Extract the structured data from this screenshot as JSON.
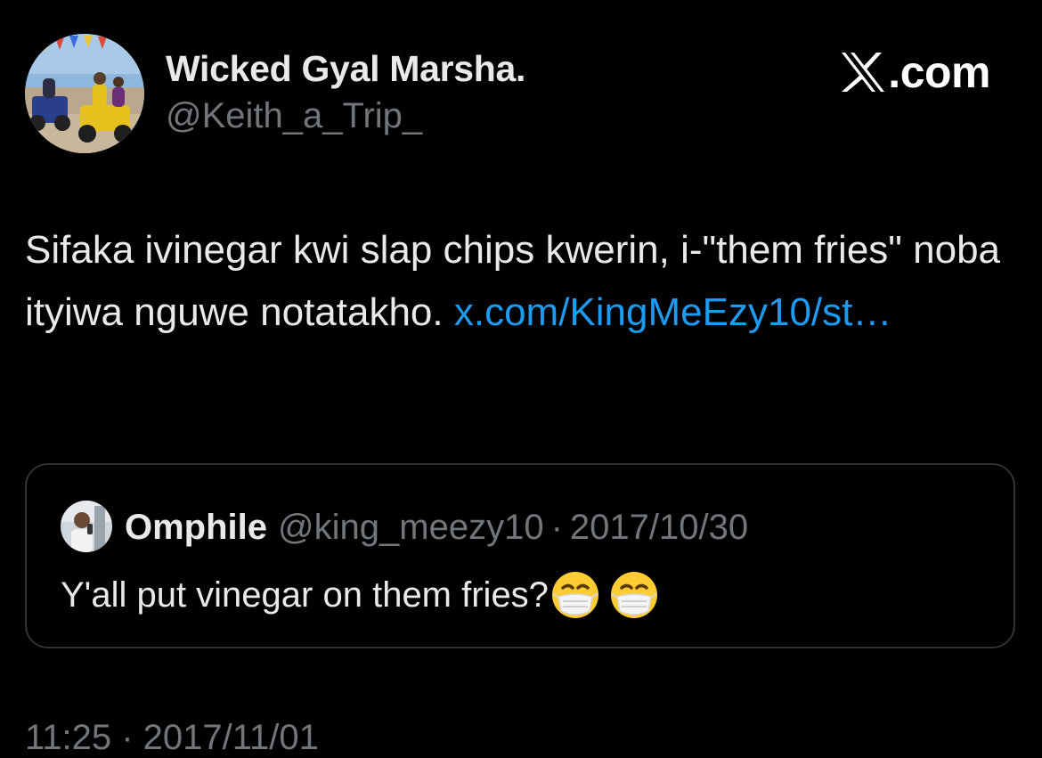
{
  "author": {
    "display_name": "Wicked Gyal Marsha.",
    "handle": "@Keith_a_Trip_"
  },
  "brand": {
    "text": ".com",
    "icon": "x-logo-icon"
  },
  "tweet": {
    "text": "Sifaka ivinegar kwi slap chips kwerin, i-\"them fries\" noba ityiwa nguwe notatakho. ",
    "link_text": "x.com/KingMeEzy10/st…"
  },
  "quote": {
    "name": "Omphile",
    "handle": "@king_meezy10",
    "separator": "·",
    "date": "2017/10/30",
    "text": "Y'all put vinegar on them fries?",
    "emoji": [
      "face-with-medical-mask-icon",
      "face-with-medical-mask-icon"
    ]
  },
  "footer": {
    "timestamp": "11:25 · 2017/11/01"
  },
  "colors": {
    "background": "#000000",
    "text_primary": "#e7e9ea",
    "text_secondary": "#71767b",
    "link": "#1d9bf0",
    "border": "#2f3336"
  }
}
